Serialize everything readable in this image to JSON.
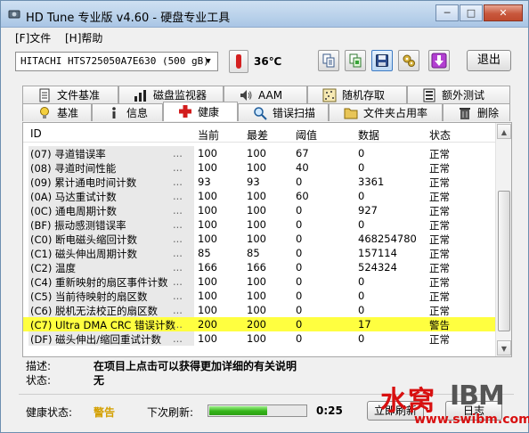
{
  "window": {
    "title": "HD Tune 专业版 v4.60 - 硬盘专业工具",
    "min_glyph": "─",
    "max_glyph": "□",
    "close_glyph": "✕"
  },
  "menu": [
    {
      "label": "[F]文件"
    },
    {
      "label": "[H]帮助"
    }
  ],
  "toolbar": {
    "drive": "HITACHI HTS725050A7E630 (500 gB)",
    "temperature": "36℃",
    "exit_label": "退出",
    "icons": [
      "copy-text-icon",
      "copy-screenshot-icon",
      "save-icon",
      "options-icon",
      "download-icon"
    ]
  },
  "tabs": {
    "row1": [
      {
        "label": "文件基准",
        "icon": "document-icon"
      },
      {
        "label": "磁盘监视器",
        "icon": "bar-chart-icon"
      },
      {
        "label": "AAM",
        "icon": "speaker-icon"
      },
      {
        "label": "随机存取",
        "icon": "dots-grid-icon"
      },
      {
        "label": "额外测试",
        "icon": "list-icon"
      }
    ],
    "row2": [
      {
        "label": "基准",
        "icon": "lightbulb-icon"
      },
      {
        "label": "信息",
        "icon": "info-icon"
      },
      {
        "label": "健康",
        "icon": "health-cross-icon",
        "selected": true
      },
      {
        "label": "错误扫描",
        "icon": "magnifier-icon"
      },
      {
        "label": "文件夹占用率",
        "icon": "folder-icon"
      },
      {
        "label": "删除",
        "icon": "trash-icon"
      }
    ]
  },
  "smart_table": {
    "columns": [
      "ID",
      "当前",
      "最差",
      "阈值",
      "数据",
      "状态"
    ],
    "rows": [
      {
        "id": "(07) 寻道错误率",
        "current": "100",
        "worst": "100",
        "threshold": "67",
        "data": "0",
        "status": "正常",
        "warn": false
      },
      {
        "id": "(08) 寻道时间性能",
        "current": "100",
        "worst": "100",
        "threshold": "40",
        "data": "0",
        "status": "正常",
        "warn": false
      },
      {
        "id": "(09) 累计通电时间计数",
        "current": "93",
        "worst": "93",
        "threshold": "0",
        "data": "3361",
        "status": "正常",
        "warn": false
      },
      {
        "id": "(0A) 马达重试计数",
        "current": "100",
        "worst": "100",
        "threshold": "60",
        "data": "0",
        "status": "正常",
        "warn": false
      },
      {
        "id": "(0C) 通电周期计数",
        "current": "100",
        "worst": "100",
        "threshold": "0",
        "data": "927",
        "status": "正常",
        "warn": false
      },
      {
        "id": "(BF) 振动感测错误率",
        "current": "100",
        "worst": "100",
        "threshold": "0",
        "data": "0",
        "status": "正常",
        "warn": false
      },
      {
        "id": "(C0) 断电磁头缩回计数",
        "current": "100",
        "worst": "100",
        "threshold": "0",
        "data": "468254780",
        "status": "正常",
        "warn": false
      },
      {
        "id": "(C1) 磁头伸出周期计数",
        "current": "85",
        "worst": "85",
        "threshold": "0",
        "data": "157114",
        "status": "正常",
        "warn": false
      },
      {
        "id": "(C2) 温度",
        "current": "166",
        "worst": "166",
        "threshold": "0",
        "data": "524324",
        "status": "正常",
        "warn": false
      },
      {
        "id": "(C4) 重新映射的扇区事件计数",
        "current": "100",
        "worst": "100",
        "threshold": "0",
        "data": "0",
        "status": "正常",
        "warn": false
      },
      {
        "id": "(C5) 当前待映射的扇区数",
        "current": "100",
        "worst": "100",
        "threshold": "0",
        "data": "0",
        "status": "正常",
        "warn": false
      },
      {
        "id": "(C6) 脱机无法校正的扇区数",
        "current": "100",
        "worst": "100",
        "threshold": "0",
        "data": "0",
        "status": "正常",
        "warn": false
      },
      {
        "id": "(C7) Ultra DMA CRC 错误计数",
        "current": "200",
        "worst": "200",
        "threshold": "0",
        "data": "17",
        "status": "警告",
        "warn": true
      },
      {
        "id": "(DF) 磁头伸出/缩回重试计数",
        "current": "100",
        "worst": "100",
        "threshold": "0",
        "data": "0",
        "status": "正常",
        "warn": false
      }
    ],
    "dots": "..."
  },
  "details": {
    "desc_label": "描述:",
    "desc_value": "在项目上点击可以获得更加详细的有关说明",
    "state_label": "状态:",
    "state_value": "无"
  },
  "status_bar": {
    "health_label": "健康状态:",
    "health_value": "警告",
    "refresh_label": "下次刷新:",
    "refresh_progress": 0.6,
    "countdown": "0:25",
    "refresh_button": "立即刷新",
    "log_button": "日志"
  },
  "watermark": {
    "cn": "水窝",
    "logo": "IBM",
    "url": "www.swibm.com"
  },
  "colors": {
    "warn_row": "#ffff40",
    "warn_text": "#d4a000",
    "accent_red": "#d81010"
  }
}
